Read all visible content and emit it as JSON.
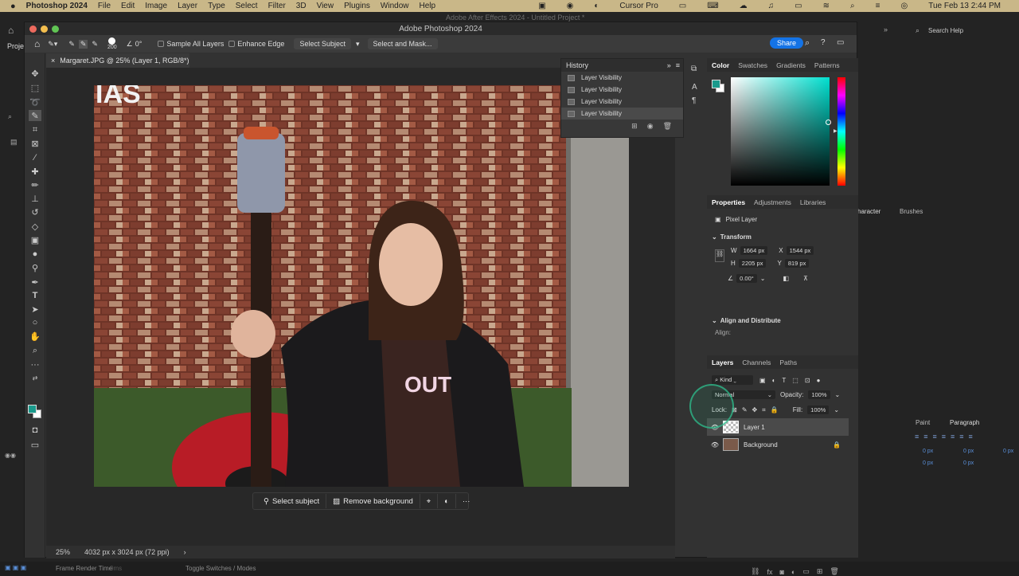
{
  "menubar": {
    "app": "Photoshop 2024",
    "items": [
      "File",
      "Edit",
      "Image",
      "Layer",
      "Type",
      "Select",
      "Filter",
      "3D",
      "View",
      "Plugins",
      "Window",
      "Help"
    ],
    "cursor_app": "Cursor Pro",
    "clock": "Tue Feb 13  2:44 PM"
  },
  "ae_title": "Adobe After Effects 2024 - Untitled Project *",
  "window_title": "Adobe Photoshop 2024",
  "options_bar": {
    "brush_size": "200",
    "angle": "0°",
    "sample_all_layers": "Sample All Layers",
    "enhance_edge": "Enhance Edge",
    "select_subject": "Select Subject",
    "select_and_mask": "Select and Mask...",
    "share": "Share"
  },
  "document_tab": "Margaret.JPG @ 25% (Layer 1, RGB/8*) *",
  "photo_text": "IAS",
  "shirt_text": "OUT",
  "contextual_bar": {
    "select_subject": "Select subject",
    "remove_background": "Remove background"
  },
  "status_bar": {
    "zoom": "25%",
    "doc_info": "4032 px x 3024 px (72 ppi)"
  },
  "history": {
    "title": "History",
    "items": [
      "Layer Visibility",
      "Layer Visibility",
      "Layer Visibility",
      "Layer Visibility"
    ]
  },
  "color_panel": {
    "tabs": [
      "Color",
      "Swatches",
      "Gradients",
      "Patterns"
    ],
    "foreground": "#1a9a8c",
    "background": "#ffffff"
  },
  "properties_panel": {
    "tabs": [
      "Properties",
      "Adjustments",
      "Libraries"
    ],
    "kind": "Pixel Layer",
    "transform_label": "Transform",
    "w_label": "W",
    "w": "1664 px",
    "x_label": "X",
    "x": "1544 px",
    "h_label": "H",
    "h": "2205 px",
    "y_label": "Y",
    "y": "819 px",
    "angle": "0.00°",
    "align_label": "Align and Distribute",
    "align_sub": "Align:"
  },
  "layers_panel": {
    "tabs": [
      "Layers",
      "Channels",
      "Paths"
    ],
    "filter": "Kind",
    "blend_mode": "Normal",
    "opacity_label": "Opacity:",
    "opacity": "100%",
    "lock_label": "Lock:",
    "fill_label": "Fill:",
    "fill": "100%",
    "layers": [
      {
        "name": "Layer 1"
      },
      {
        "name": "Background"
      }
    ]
  },
  "ae": {
    "search_placeholder": "Search Help",
    "char_tab": "haracter",
    "brushes_tab": "Brushes",
    "paint_tab": "Paint",
    "paragraph_tab": "Paragraph",
    "px": "0 px",
    "project_tab": "Projec",
    "frame_render_label": "Frame Render Time",
    "frame_render_value": "0ms",
    "toggle": "Toggle Switches / Modes"
  }
}
